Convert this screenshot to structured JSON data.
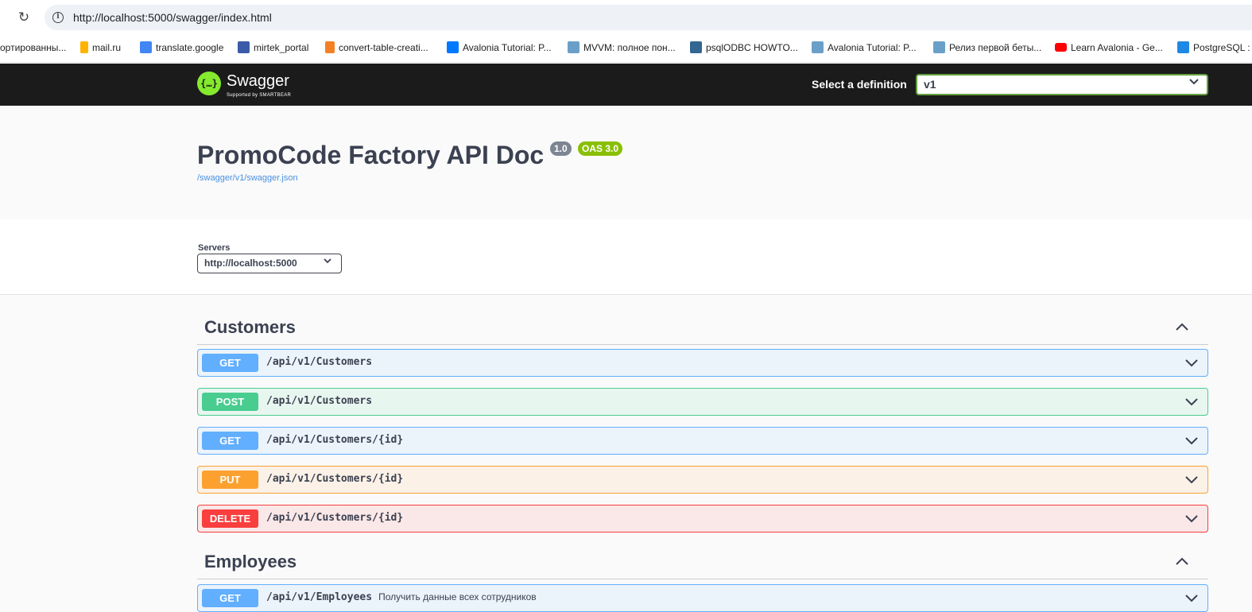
{
  "browser": {
    "url": "http://localhost:5000/swagger/index.html",
    "bookmarks": [
      {
        "label": "ортированны...",
        "icon": "folder-icon",
        "color": "#ffffff"
      },
      {
        "label": "mail.ru",
        "icon": "mailru-icon",
        "color": "#ffb300"
      },
      {
        "label": "translate.google",
        "icon": "google-translate-icon",
        "color": "#4285f4"
      },
      {
        "label": "mirtek_portal",
        "icon": "mirtek-icon",
        "color": "#3b5ba8"
      },
      {
        "label": "convert-table-creati...",
        "icon": "stackoverflow-icon",
        "color": "#f48024"
      },
      {
        "label": "Avalonia Tutorial: P...",
        "icon": "avalonia-icon",
        "color": "#0078ff"
      },
      {
        "label": "MVVM: полное пон...",
        "icon": "habr-icon",
        "color": "#6aa0c8"
      },
      {
        "label": "psqlODBC HOWTO...",
        "icon": "postgres-icon",
        "color": "#336791"
      },
      {
        "label": "Avalonia Tutorial: P...",
        "icon": "habr-icon",
        "color": "#6aa0c8"
      },
      {
        "label": "Релиз первой беты...",
        "icon": "habr-icon",
        "color": "#6aa0c8"
      },
      {
        "label": "Learn Avalonia - Ge...",
        "icon": "youtube-icon",
        "color": "#ff0000"
      },
      {
        "label": "PostgreSQL :",
        "icon": "postgrespro-icon",
        "color": "#1e88e5"
      }
    ]
  },
  "topbar": {
    "logo_name": "Swagger",
    "logo_sub": "Supported by SMARTBEAR",
    "logo_glyph": "{…}",
    "definition_label": "Select a definition",
    "definition_value": "v1"
  },
  "info": {
    "title": "PromoCode Factory API Doc",
    "version": "1.0",
    "oas": "OAS 3.0",
    "spec_url": "/swagger/v1/swagger.json"
  },
  "servers": {
    "label": "Servers",
    "value": "http://localhost:5000"
  },
  "tags": [
    {
      "name": "Customers",
      "operations": [
        {
          "method": "GET",
          "path": "/api/v1/Customers",
          "desc": ""
        },
        {
          "method": "POST",
          "path": "/api/v1/Customers",
          "desc": ""
        },
        {
          "method": "GET",
          "path": "/api/v1/Customers/{id}",
          "desc": ""
        },
        {
          "method": "PUT",
          "path": "/api/v1/Customers/{id}",
          "desc": ""
        },
        {
          "method": "DELETE",
          "path": "/api/v1/Customers/{id}",
          "desc": ""
        }
      ]
    },
    {
      "name": "Employees",
      "operations": [
        {
          "method": "GET",
          "path": "/api/v1/Employees",
          "desc": "Получить данные всех сотрудников"
        }
      ]
    }
  ],
  "colors": {
    "get": "#61affe",
    "post": "#49cc90",
    "put": "#fca130",
    "delete": "#f93e3e",
    "swagger_green": "#85ea2d"
  }
}
